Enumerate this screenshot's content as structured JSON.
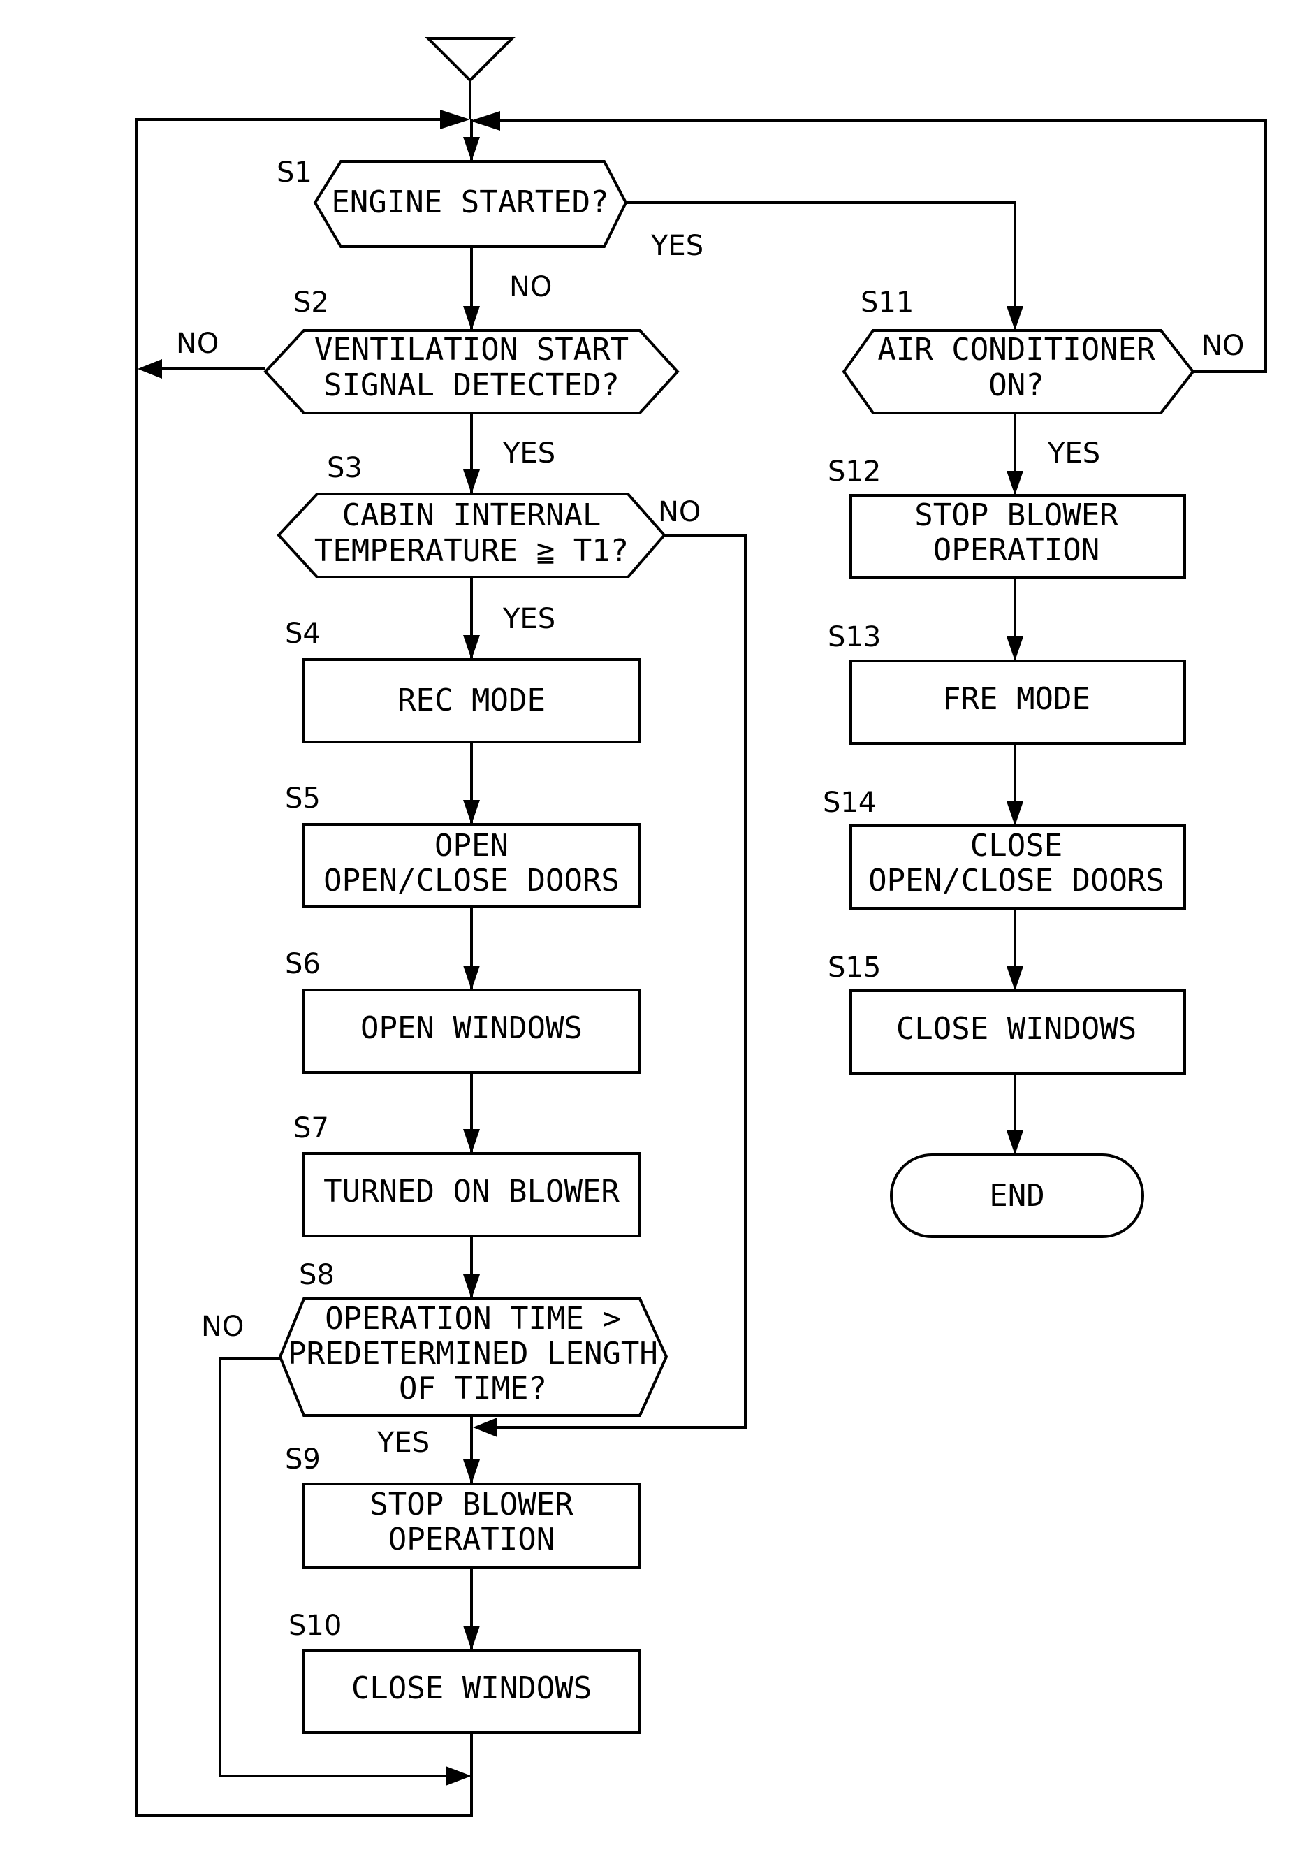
{
  "flowchart": {
    "start_symbol": "start-triangle",
    "steps": {
      "s1": {
        "id": "S1",
        "type": "decision",
        "lines": [
          "ENGINE STARTED?"
        ]
      },
      "s2": {
        "id": "S2",
        "type": "decision",
        "lines": [
          "VENTILATION START",
          "SIGNAL DETECTED?"
        ]
      },
      "s3": {
        "id": "S3",
        "type": "decision",
        "lines": [
          "CABIN INTERNAL",
          "TEMPERATURE ≧ T1?"
        ]
      },
      "s4": {
        "id": "S4",
        "type": "process",
        "lines": [
          "REC MODE"
        ]
      },
      "s5": {
        "id": "S5",
        "type": "process",
        "lines": [
          "OPEN",
          "OPEN/CLOSE DOORS"
        ]
      },
      "s6": {
        "id": "S6",
        "type": "process",
        "lines": [
          "OPEN WINDOWS"
        ]
      },
      "s7": {
        "id": "S7",
        "type": "process",
        "lines": [
          "TURNED ON BLOWER"
        ]
      },
      "s8": {
        "id": "S8",
        "type": "decision",
        "lines": [
          "OPERATION TIME >",
          "PREDETERMINED LENGTH",
          "OF TIME?"
        ]
      },
      "s9": {
        "id": "S9",
        "type": "process",
        "lines": [
          "STOP BLOWER",
          "OPERATION"
        ]
      },
      "s10": {
        "id": "S10",
        "type": "process",
        "lines": [
          "CLOSE WINDOWS"
        ]
      },
      "s11": {
        "id": "S11",
        "type": "decision",
        "lines": [
          "AIR CONDITIONER",
          "ON?"
        ]
      },
      "s12": {
        "id": "S12",
        "type": "process",
        "lines": [
          "STOP BLOWER",
          "OPERATION"
        ]
      },
      "s13": {
        "id": "S13",
        "type": "process",
        "lines": [
          "FRE MODE"
        ]
      },
      "s14": {
        "id": "S14",
        "type": "process",
        "lines": [
          "CLOSE",
          "OPEN/CLOSE DOORS"
        ]
      },
      "s15": {
        "id": "S15",
        "type": "process",
        "lines": [
          "CLOSE WINDOWS"
        ]
      },
      "end": {
        "type": "terminator",
        "lines": [
          "END"
        ]
      }
    },
    "branch_labels": {
      "s1_yes": "YES",
      "s1_no": "NO",
      "s2_no": "NO",
      "s2_yes": "YES",
      "s3_no": "NO",
      "s3_yes": "YES",
      "s8_no": "NO",
      "s8_yes": "YES",
      "s11_no": "NO",
      "s11_yes": "YES"
    }
  }
}
